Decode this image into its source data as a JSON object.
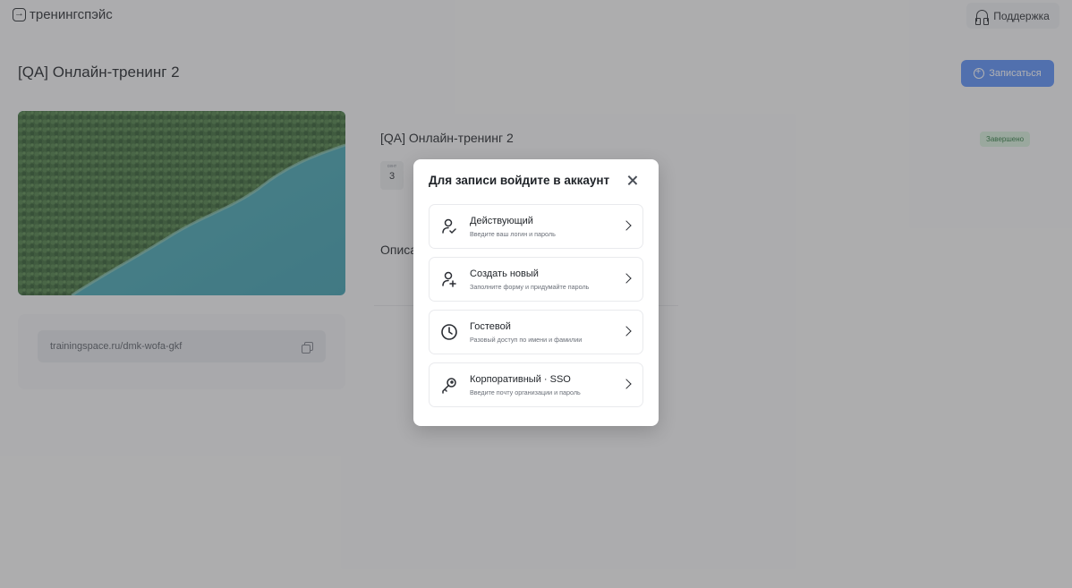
{
  "header": {
    "logo_text": "тренингспэйс",
    "support_label": "Поддержка"
  },
  "page": {
    "title": "[QA] Онлайн-тренинг 2",
    "enroll_label": "Записаться",
    "link": "trainingspace.ru/dmk-wofa-gkf"
  },
  "training": {
    "title": "[QA] Онлайн-тренинг 2",
    "status": "Завершено",
    "date_month": "сент",
    "date_day": "3",
    "description_label": "Описание"
  },
  "modal": {
    "title": "Для записи войдите в аккаунт",
    "options": [
      {
        "title": "Действующий",
        "subtitle": "Введите ваш логин и пароль",
        "icon": "user-check-icon"
      },
      {
        "title": "Создать новый",
        "subtitle": "Заполните форму и придумайте пароль",
        "icon": "user-plus-icon"
      },
      {
        "title": "Гостевой",
        "subtitle": "Разовый доступ по имени и фамилии",
        "icon": "clock-icon"
      },
      {
        "title": "Корпоративный · SSO",
        "subtitle": "Введите почту организации и пароль",
        "icon": "key-icon"
      }
    ]
  },
  "colors": {
    "accent": "#5b8ff9",
    "status_bg": "#d7f0dc",
    "status_text": "#2f7a43",
    "overlay": "rgba(70,70,72,0.42)"
  }
}
